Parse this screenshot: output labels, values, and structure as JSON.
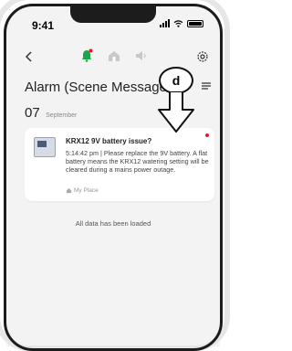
{
  "status_bar": {
    "time": "9:41"
  },
  "page": {
    "title": "Alarm (Scene Message"
  },
  "date_group": {
    "day": "07",
    "month": "September"
  },
  "notification": {
    "title": "KRX12 9V battery issue?",
    "body": "5:14:42 pm | Please replace the 9V battery. A flat battery means the KRX12 watering setting will be cleared during a mains power outage.",
    "place": "My Place",
    "unread": true
  },
  "footer_text": "All data has been loaded",
  "annotation": {
    "label": "d"
  },
  "colors": {
    "accent_green": "#19a64a",
    "alert_red": "#e02020"
  }
}
